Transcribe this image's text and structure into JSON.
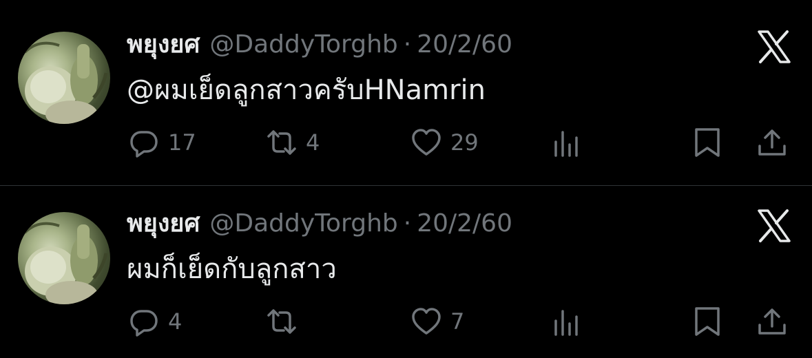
{
  "tweets": [
    {
      "display_name": "พยุงยศ",
      "handle": "@DaddyTorghb",
      "separator": "·",
      "date": "20/2/60",
      "text": "@ผมเย็ดลูกสาวครับHNamrin",
      "counts": {
        "replies": "17",
        "retweets": "4",
        "likes": "29"
      }
    },
    {
      "display_name": "พยุงยศ",
      "handle": "@DaddyTorghb",
      "separator": "·",
      "date": "20/2/60",
      "text": "ผมก็เย็ดกับลูกสาว",
      "counts": {
        "replies": "4",
        "retweets": "",
        "likes": "7"
      }
    }
  ],
  "icons": {
    "brand": "x-logo-icon",
    "reply": "reply-icon",
    "retweet": "retweet-icon",
    "like": "heart-icon",
    "views": "views-icon",
    "bookmark": "bookmark-icon",
    "share": "share-icon"
  },
  "colors": {
    "background": "#000000",
    "text": "#e7e9ea",
    "muted": "#71767b",
    "divider": "#2f3336"
  }
}
